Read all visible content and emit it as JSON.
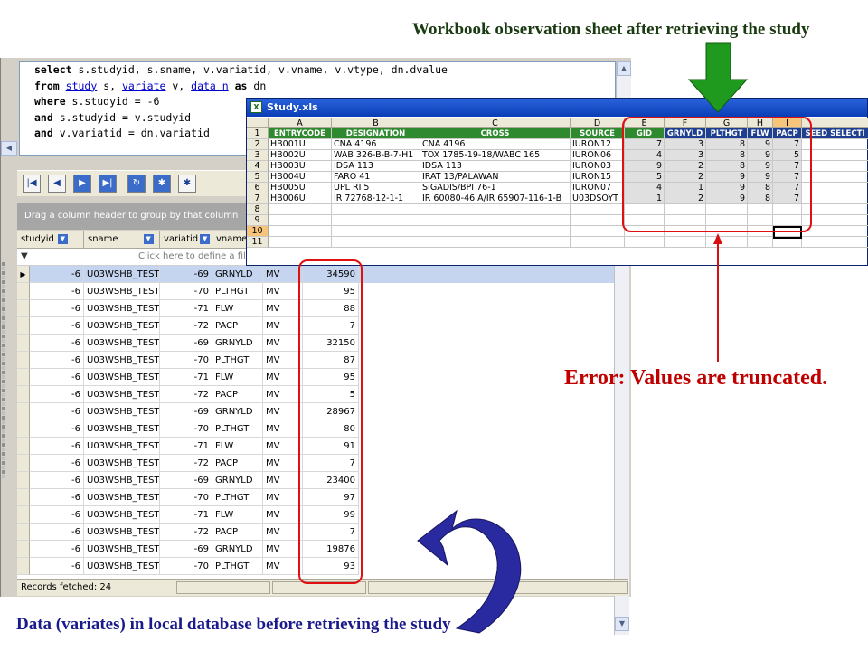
{
  "sql_editor": {
    "lines": [
      [
        {
          "t": "select",
          "k": "kw"
        },
        {
          "t": " s.studyid, s.sname, v.variatid, v.vname, v.vtype, dn.dvalue"
        }
      ],
      [
        {
          "t": "from",
          "k": "kw"
        },
        {
          "t": " "
        },
        {
          "t": "study",
          "k": "link"
        },
        {
          "t": " s, "
        },
        {
          "t": "variate",
          "k": "link"
        },
        {
          "t": " v, "
        },
        {
          "t": "data n",
          "k": "link"
        },
        {
          "t": " "
        },
        {
          "t": "as",
          "k": "kw"
        },
        {
          "t": " dn"
        }
      ],
      [
        {
          "t": "where",
          "k": "kw"
        },
        {
          "t": " s.studyid = -6"
        }
      ],
      [
        {
          "t": "and",
          "k": "kw"
        },
        {
          "t": " s.studyid = v.studyid"
        }
      ],
      [
        {
          "t": "and",
          "k": "kw"
        },
        {
          "t": " v.variatid = dn.variatid"
        }
      ]
    ]
  },
  "results_grid": {
    "group_hint": "Drag a column header to group by that column",
    "filter_hint": "Click here to define a filter",
    "columns": [
      "studyid",
      "sname",
      "variatid",
      "vname",
      "",
      ""
    ],
    "rows": [
      [
        "-6",
        "U03WSHB_TEST",
        "-69",
        "GRNYLD",
        "MV",
        "34590"
      ],
      [
        "-6",
        "U03WSHB_TEST",
        "-70",
        "PLTHGT",
        "MV",
        "95"
      ],
      [
        "-6",
        "U03WSHB_TEST",
        "-71",
        "FLW",
        "MV",
        "88"
      ],
      [
        "-6",
        "U03WSHB_TEST",
        "-72",
        "PACP",
        "MV",
        "7"
      ],
      [
        "-6",
        "U03WSHB_TEST",
        "-69",
        "GRNYLD",
        "MV",
        "32150"
      ],
      [
        "-6",
        "U03WSHB_TEST",
        "-70",
        "PLTHGT",
        "MV",
        "87"
      ],
      [
        "-6",
        "U03WSHB_TEST",
        "-71",
        "FLW",
        "MV",
        "95"
      ],
      [
        "-6",
        "U03WSHB_TEST",
        "-72",
        "PACP",
        "MV",
        "5"
      ],
      [
        "-6",
        "U03WSHB_TEST",
        "-69",
        "GRNYLD",
        "MV",
        "28967"
      ],
      [
        "-6",
        "U03WSHB_TEST",
        "-70",
        "PLTHGT",
        "MV",
        "80"
      ],
      [
        "-6",
        "U03WSHB_TEST",
        "-71",
        "FLW",
        "MV",
        "91"
      ],
      [
        "-6",
        "U03WSHB_TEST",
        "-72",
        "PACP",
        "MV",
        "7"
      ],
      [
        "-6",
        "U03WSHB_TEST",
        "-69",
        "GRNYLD",
        "MV",
        "23400"
      ],
      [
        "-6",
        "U03WSHB_TEST",
        "-70",
        "PLTHGT",
        "MV",
        "97"
      ],
      [
        "-6",
        "U03WSHB_TEST",
        "-71",
        "FLW",
        "MV",
        "99"
      ],
      [
        "-6",
        "U03WSHB_TEST",
        "-72",
        "PACP",
        "MV",
        "7"
      ],
      [
        "-6",
        "U03WSHB_TEST",
        "-69",
        "GRNYLD",
        "MV",
        "19876"
      ],
      [
        "-6",
        "U03WSHB_TEST",
        "-70",
        "PLTHGT",
        "MV",
        "93"
      ]
    ],
    "status": "Records fetched: 24"
  },
  "excel": {
    "title": "Study.xls",
    "col_letters": [
      "A",
      "B",
      "C",
      "D",
      "E",
      "F",
      "G",
      "H",
      "I",
      "J"
    ],
    "header_row": [
      "ENTRYCODE",
      "DESIGNATION",
      "CROSS",
      "SOURCE",
      "GID",
      "GRNYLD",
      "PLTHGT",
      "FLW",
      "PACP",
      "SEED SELECTI"
    ],
    "rows": [
      [
        "HB001U",
        "CNA 4196",
        "CNA 4196",
        "IURON12",
        "7",
        "3",
        "8",
        "9",
        "7",
        ""
      ],
      [
        "HB002U",
        "WAB 326-B-B-7-H1",
        "TOX 1785-19-18/WABC 165",
        "IURON06",
        "4",
        "3",
        "8",
        "9",
        "5",
        ""
      ],
      [
        "HB003U",
        "IDSA 113",
        "IDSA 113",
        "IURON03",
        "9",
        "2",
        "8",
        "9",
        "7",
        ""
      ],
      [
        "HB004U",
        "FARO 41",
        "IRAT 13/PALAWAN",
        "IURON15",
        "5",
        "2",
        "9",
        "9",
        "7",
        ""
      ],
      [
        "HB005U",
        "UPL RI 5",
        "SIGADIS/BPI 76-1",
        "IURON07",
        "4",
        "1",
        "9",
        "8",
        "7",
        ""
      ],
      [
        "HB006U",
        "IR 72768-12-1-1",
        "IR 60080-46 A/IR 65907-116-1-B",
        "U03DSOYT",
        "1",
        "2",
        "9",
        "8",
        "7",
        ""
      ]
    ],
    "row_numbers": [
      "1",
      "2",
      "3",
      "4",
      "5",
      "6",
      "7",
      "8",
      "9",
      "10",
      "11"
    ]
  },
  "annotations": {
    "top": "Workbook observation sheet after retrieving the study",
    "error": "Error: Values are truncated.",
    "bottom": "Data (variates) in local database before retrieving the study"
  },
  "colors": {
    "excel_header_green": "#2f8a2f",
    "excel_header_blue": "#1e3f8f",
    "error_red": "#c00000",
    "arrow_green": "#1f9a1f",
    "arrow_blue": "#2a2aa0"
  }
}
